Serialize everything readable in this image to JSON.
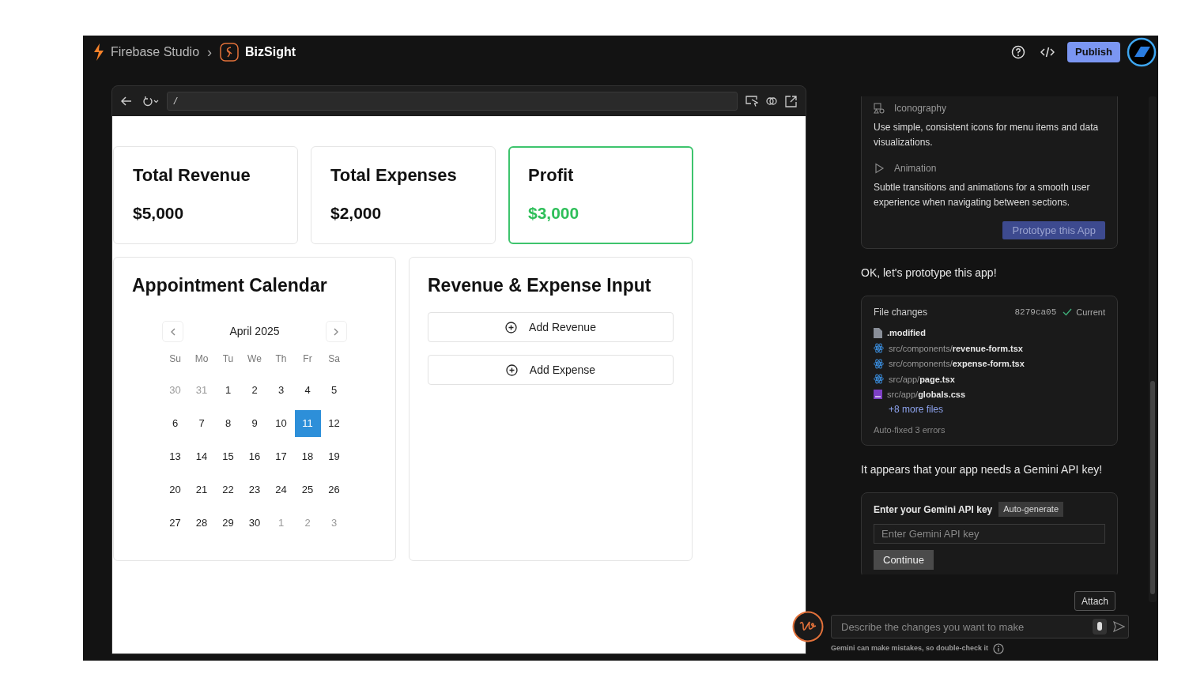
{
  "header": {
    "product": "Firebase Studio",
    "separator": "›",
    "project": "BizSight",
    "publish": "Publish"
  },
  "browser": {
    "url": "/"
  },
  "stats": [
    {
      "label": "Total Revenue",
      "value": "$5,000",
      "highlighted": false
    },
    {
      "label": "Total Expenses",
      "value": "$2,000",
      "highlighted": false
    },
    {
      "label": "Profit",
      "value": "$3,000",
      "highlighted": true
    }
  ],
  "calendar": {
    "title": "Appointment Calendar",
    "month": "April 2025",
    "weekdays": [
      "Su",
      "Mo",
      "Tu",
      "We",
      "Th",
      "Fr",
      "Sa"
    ],
    "days": [
      {
        "label": "30",
        "muted": true,
        "selected": false
      },
      {
        "label": "31",
        "muted": true,
        "selected": false
      },
      {
        "label": "1",
        "muted": false,
        "selected": false
      },
      {
        "label": "2",
        "muted": false,
        "selected": false
      },
      {
        "label": "3",
        "muted": false,
        "selected": false
      },
      {
        "label": "4",
        "muted": false,
        "selected": false
      },
      {
        "label": "5",
        "muted": false,
        "selected": false
      },
      {
        "label": "6",
        "muted": false,
        "selected": false
      },
      {
        "label": "7",
        "muted": false,
        "selected": false
      },
      {
        "label": "8",
        "muted": false,
        "selected": false
      },
      {
        "label": "9",
        "muted": false,
        "selected": false
      },
      {
        "label": "10",
        "muted": false,
        "selected": false
      },
      {
        "label": "11",
        "muted": false,
        "selected": true
      },
      {
        "label": "12",
        "muted": false,
        "selected": false
      },
      {
        "label": "13",
        "muted": false,
        "selected": false
      },
      {
        "label": "14",
        "muted": false,
        "selected": false
      },
      {
        "label": "15",
        "muted": false,
        "selected": false
      },
      {
        "label": "16",
        "muted": false,
        "selected": false
      },
      {
        "label": "17",
        "muted": false,
        "selected": false
      },
      {
        "label": "18",
        "muted": false,
        "selected": false
      },
      {
        "label": "19",
        "muted": false,
        "selected": false
      },
      {
        "label": "20",
        "muted": false,
        "selected": false
      },
      {
        "label": "21",
        "muted": false,
        "selected": false
      },
      {
        "label": "22",
        "muted": false,
        "selected": false
      },
      {
        "label": "23",
        "muted": false,
        "selected": false
      },
      {
        "label": "24",
        "muted": false,
        "selected": false
      },
      {
        "label": "25",
        "muted": false,
        "selected": false
      },
      {
        "label": "26",
        "muted": false,
        "selected": false
      },
      {
        "label": "27",
        "muted": false,
        "selected": false
      },
      {
        "label": "28",
        "muted": false,
        "selected": false
      },
      {
        "label": "29",
        "muted": false,
        "selected": false
      },
      {
        "label": "30",
        "muted": false,
        "selected": false
      },
      {
        "label": "1",
        "muted": true,
        "selected": false
      },
      {
        "label": "2",
        "muted": true,
        "selected": false
      },
      {
        "label": "3",
        "muted": true,
        "selected": false
      }
    ]
  },
  "input_panel": {
    "title": "Revenue & Expense Input",
    "buttons": [
      "Add Revenue",
      "Add Expense"
    ]
  },
  "chat": {
    "guidelines": [
      {
        "kind": "iconography",
        "heading": "Iconography",
        "text": "Use simple, consistent icons for menu items and data visualizations."
      },
      {
        "kind": "animation",
        "heading": "Animation",
        "text": "Subtle transitions and animations for a smooth user experience when navigating between sections."
      }
    ],
    "prototype_button": "Prototype this App",
    "message_1": "OK, let's prototype this app!",
    "file_changes": {
      "title": "File changes",
      "commit": "8279ca05",
      "status": "Current",
      "files": [
        {
          "kind": "file",
          "name": ".modified"
        },
        {
          "kind": "react",
          "dir": "src/components/",
          "name": "revenue-form.tsx"
        },
        {
          "kind": "react",
          "dir": "src/components/",
          "name": "expense-form.tsx"
        },
        {
          "kind": "react",
          "dir": "src/app/",
          "name": "page.tsx"
        },
        {
          "kind": "css",
          "dir": "src/app/",
          "name": "globals.css"
        }
      ],
      "more": "+8 more files",
      "note": "Auto-fixed 3 errors"
    },
    "message_2": "It appears that your app needs a Gemini API key!",
    "api_key": {
      "label": "Enter your Gemini API key",
      "auto": "Auto-generate",
      "placeholder": "Enter Gemini API key",
      "submit": "Continue"
    },
    "attach": "Attach",
    "prompt_placeholder": "Describe the changes you want to make",
    "disclaimer": "Gemini can make mistakes, so double-check it"
  }
}
